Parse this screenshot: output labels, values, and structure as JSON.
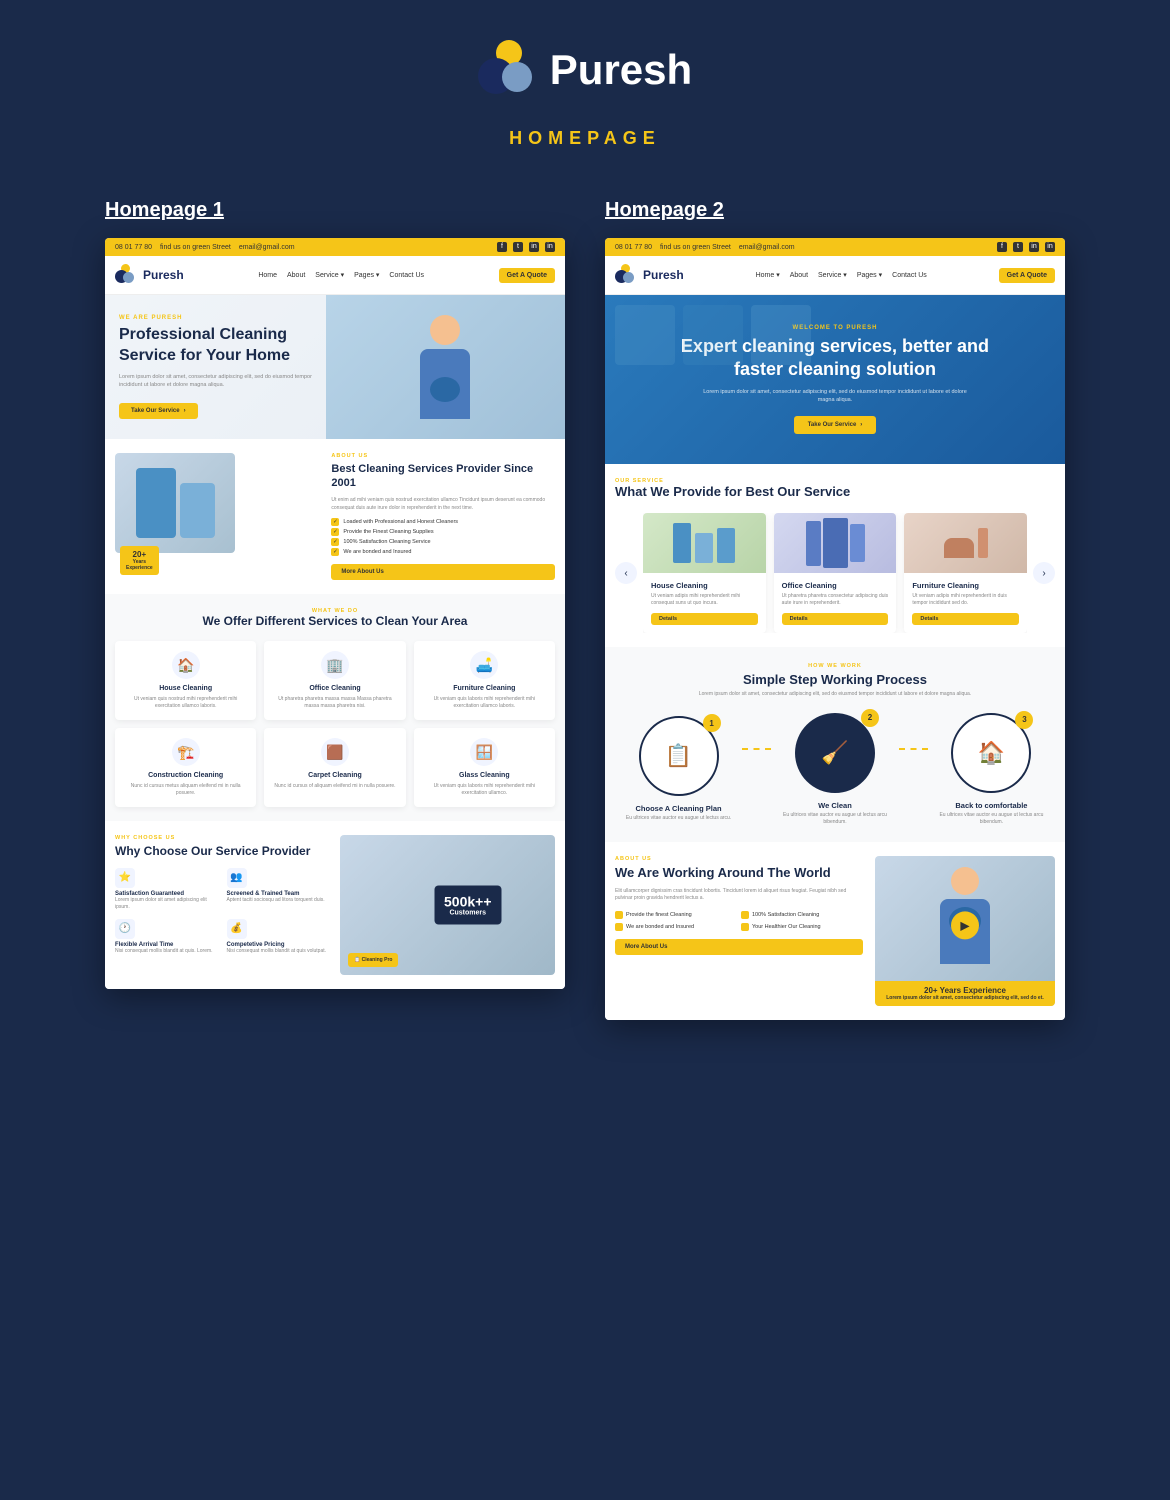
{
  "header": {
    "logo_text": "Puresh",
    "section_label": "HOMEPAGE"
  },
  "homepage1": {
    "title": "Homepage 1",
    "topbar": {
      "phone": "08 01 77 80",
      "location": "find us on green Street",
      "email": "email@gmail.com",
      "socials": [
        "f",
        "t",
        "in",
        "in"
      ]
    },
    "nav": {
      "logo_text": "Puresh",
      "links": [
        "Home",
        "About",
        "Service",
        "Pages",
        "Contact Us"
      ],
      "cta": "Get A Quote"
    },
    "hero": {
      "subtitle": "WE ARE PURESH",
      "title": "Professional Cleaning Service for Your Home",
      "description": "Lorem ipsum dolor sit amet, consectetur adipiscing elit, sed do eiusmod tempor incididunt ut labore et dolore magna aliqua.",
      "cta": "Take Our Service"
    },
    "about": {
      "label": "ABOUT US",
      "title": "Best Cleaning Services Provider Since 2001",
      "description": "Ut enim ad mihi veniam quis nostrud exercitation ullamco Tincidunt ipsum deserunt ea commodo consequat duis aute irure dolor in reprehenderit in the next time.",
      "checks": [
        "Loaded with Professional and Honest Cleaners",
        "Provide the Finest Cleaning Supplies",
        "100% Satisfaction Cleaning Service",
        "We are bonded and Insured"
      ],
      "badge": "20+ Years Experience",
      "cta": "More About Us"
    },
    "services": {
      "label": "WHAT WE DO",
      "title": "We Offer Different Services to Clean Your Area",
      "items": [
        {
          "name": "House Cleaning",
          "icon": "🏠",
          "desc": "Ut veniam quis nostrud mihi reprehenderit mihi exercitation ullamco laboris."
        },
        {
          "name": "Office Cleaning",
          "icon": "🏢",
          "desc": "Ut pharetra pharetra massa massa Massa pharetra massa massa pharetra nisi."
        },
        {
          "name": "Furniture Cleaning",
          "icon": "🛋️",
          "desc": "Ut veniam quis laboris mihi reprehenderit mihi exercitation ullamco laboris."
        },
        {
          "name": "Construction Cleaning",
          "icon": "🏗️",
          "desc": "Nunc id cursus metus aliquam eleifend mi in nulla posuere."
        },
        {
          "name": "Carpet Cleaning",
          "icon": "🟫",
          "desc": "Nunc id cursus of aliquam eleifend mi in nulla posuere."
        },
        {
          "name": "Glass Cleaning",
          "icon": "🪟",
          "desc": "Ut veniam quis laboris mihi reprehenderit mihi exercitation ullamco."
        }
      ]
    },
    "why": {
      "label": "WHY CHOOSE US",
      "title": "Why Choose Our Service Provider",
      "features": [
        {
          "name": "Satisfaction Guaranteed",
          "icon": "⭐",
          "desc": "Lorem ipsum dolor sit amet adipiscing elit ipsum."
        },
        {
          "name": "Screened & Trained Team",
          "icon": "👥",
          "desc": "Aptent taciti sociosqu ad litora torquent duis."
        },
        {
          "name": "Flexible Arrival Time",
          "icon": "🕐",
          "desc": "Nisi consequat mollis blandit at quis. Lorem."
        },
        {
          "name": "Competetive Pricing",
          "icon": "💰",
          "desc": "Nisi consequat mollis blandit at quis volutpat."
        }
      ],
      "customers_badge": "500k++ Customers"
    }
  },
  "homepage2": {
    "title": "Homepage 2",
    "topbar": {
      "phone": "08 01 77 80",
      "location": "find us on green Street",
      "email": "email@gmail.com"
    },
    "nav": {
      "logo_text": "Puresh",
      "links": [
        "Home",
        "About",
        "Service",
        "Pages",
        "Contact Us"
      ],
      "cta": "Get A Quote"
    },
    "hero": {
      "subtitle": "WELCOME TO PURESH",
      "title": "Expert cleaning services, better and faster cleaning solution",
      "description": "Lorem ipsum dolor sit amet, consectetur adipiscing elit, sed do eiusmod tempor incididunt ut labore et dolore magna aliqua.",
      "cta": "Take Our Service"
    },
    "services": {
      "label": "OUR SERVICE",
      "title": "What We Provide for Best Our Service",
      "items": [
        {
          "name": "House Cleaning",
          "icon": "🏠",
          "desc": "Ut veniam adipis mihi reprehenderit mihi consequat suns ut quo incura."
        },
        {
          "name": "Office Cleaning",
          "icon": "🏢",
          "desc": "Ut pharetra pharetra consectetur adipiscing duis aute irure in reprehenderit."
        },
        {
          "name": "Furniture Cleaning",
          "icon": "🛋️",
          "desc": "Ut veniam adipis mihi reprehenderit in duis tempor incididunt sed do."
        }
      ],
      "btn": "Details"
    },
    "process": {
      "label": "HOW WE WORK",
      "title": "Simple Step Working Process",
      "description": "Lorem ipsum dolor sit amet, consectetur adipiscing elit, sed do eiusmod tempor incididunt ut labore et dolore magna aliqua.",
      "steps": [
        {
          "number": "1",
          "title": "Choose A Cleaning Plan",
          "desc": "Eu ultrices vitae auctor eu augue ut lectus arcu."
        },
        {
          "number": "2",
          "title": "We Clean",
          "desc": "Eu ultrices vitae auctor eu augue ut lectus arcu bibendum."
        },
        {
          "number": "3",
          "title": "Back to comfortable",
          "desc": "Eu ultrices vitae auctor eu augue ut lectus arcu bibendum."
        }
      ]
    },
    "about": {
      "label": "ABOUT US",
      "title": "We Are Working Around The World",
      "description": "Elit ullamcorper dignissim cras tincidunt lobortis. Tincidunt lorem id aliquet risus feugiat. Feugiat nibh sed pulvinar proin gravida hendrerit lectus a.",
      "checks": [
        "Provide the finest Cleaning",
        "100% Satisfaction Cleaning",
        "We are bonded and Insured",
        "Your Healthier Our Cleaning"
      ],
      "cta": "More About Us",
      "badge": "20+ Years Experience"
    }
  }
}
